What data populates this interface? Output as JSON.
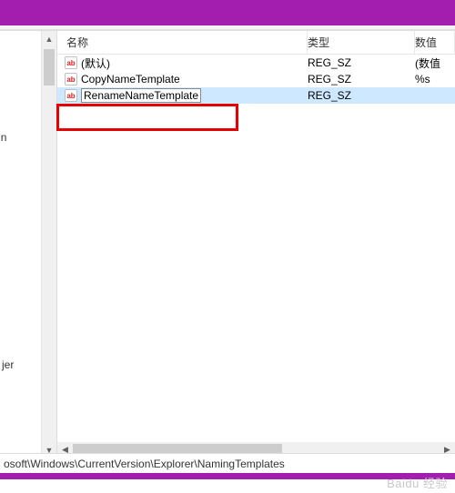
{
  "titlebar": {},
  "tree": {
    "items": [
      "",
      "gAgain",
      "jer"
    ]
  },
  "columns": {
    "name": "名称",
    "type": "类型",
    "data": "数值"
  },
  "rows": [
    {
      "name": "(默认)",
      "type": "REG_SZ",
      "data": "(数值"
    },
    {
      "name": "CopyNameTemplate",
      "type": "REG_SZ",
      "data": "%s"
    },
    {
      "name": "RenameNameTemplate",
      "type": "REG_SZ",
      "data": "",
      "editing": true,
      "selected": true
    }
  ],
  "icon_label": "ab",
  "statusbar": {
    "path": "osoft\\Windows\\CurrentVersion\\Explorer\\NamingTemplates"
  },
  "watermark": "Baidu 经验"
}
